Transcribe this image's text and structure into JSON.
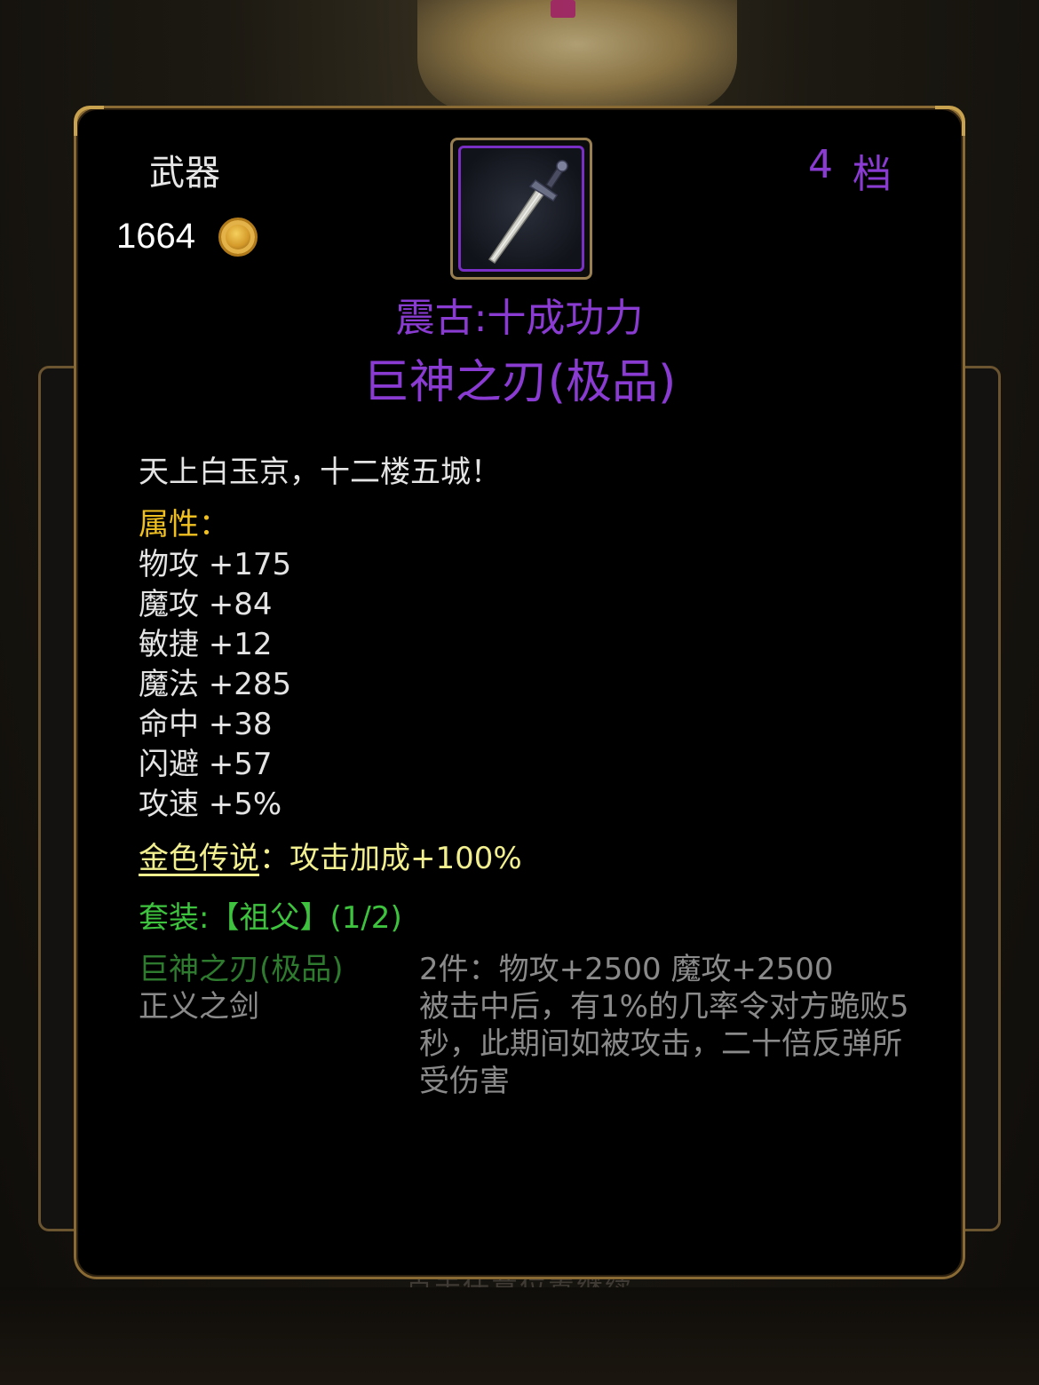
{
  "background": {
    "hint_text": "点击任意位置继续"
  },
  "item": {
    "category": "武器",
    "price": "1664",
    "tier_number": "4",
    "tier_unit": "档",
    "affix": "震古:十成功力",
    "name": "巨神之刃(极品)",
    "flavor": "天上白玉京，十二楼五城！",
    "attributes_title": "属性：",
    "stats": [
      "物攻 +175",
      "魔攻 +84",
      "敏捷 +12",
      "魔法 +285",
      "命中 +38",
      "闪避 +57",
      "攻速 +5%"
    ],
    "legend": {
      "link": "金色传说",
      "text": "：攻击加成+100%"
    },
    "set": {
      "title": "套装:【祖父】(1/2)",
      "pieces": [
        {
          "name": "巨神之刃(极品)",
          "owned": true
        },
        {
          "name": "正义之剑",
          "owned": false
        }
      ],
      "bonus_line1": "2件：物攻+2500 魔攻+2500",
      "bonus_line2": "被击中后，有1%的几率令对方跪败5秒，此期间如被攻击，二十倍反弹所受伤害"
    }
  },
  "colors": {
    "quality_purple": "#8a3bd1",
    "attr_gold": "#f0c020",
    "legend_yellow": "#f2ef8f",
    "set_green": "#3ec33e",
    "set_piece_owned": "#2e7a2e",
    "muted_gray": "#8a8a8a"
  },
  "icons": {
    "currency": "gold-coin-icon",
    "item": "sword-icon"
  }
}
